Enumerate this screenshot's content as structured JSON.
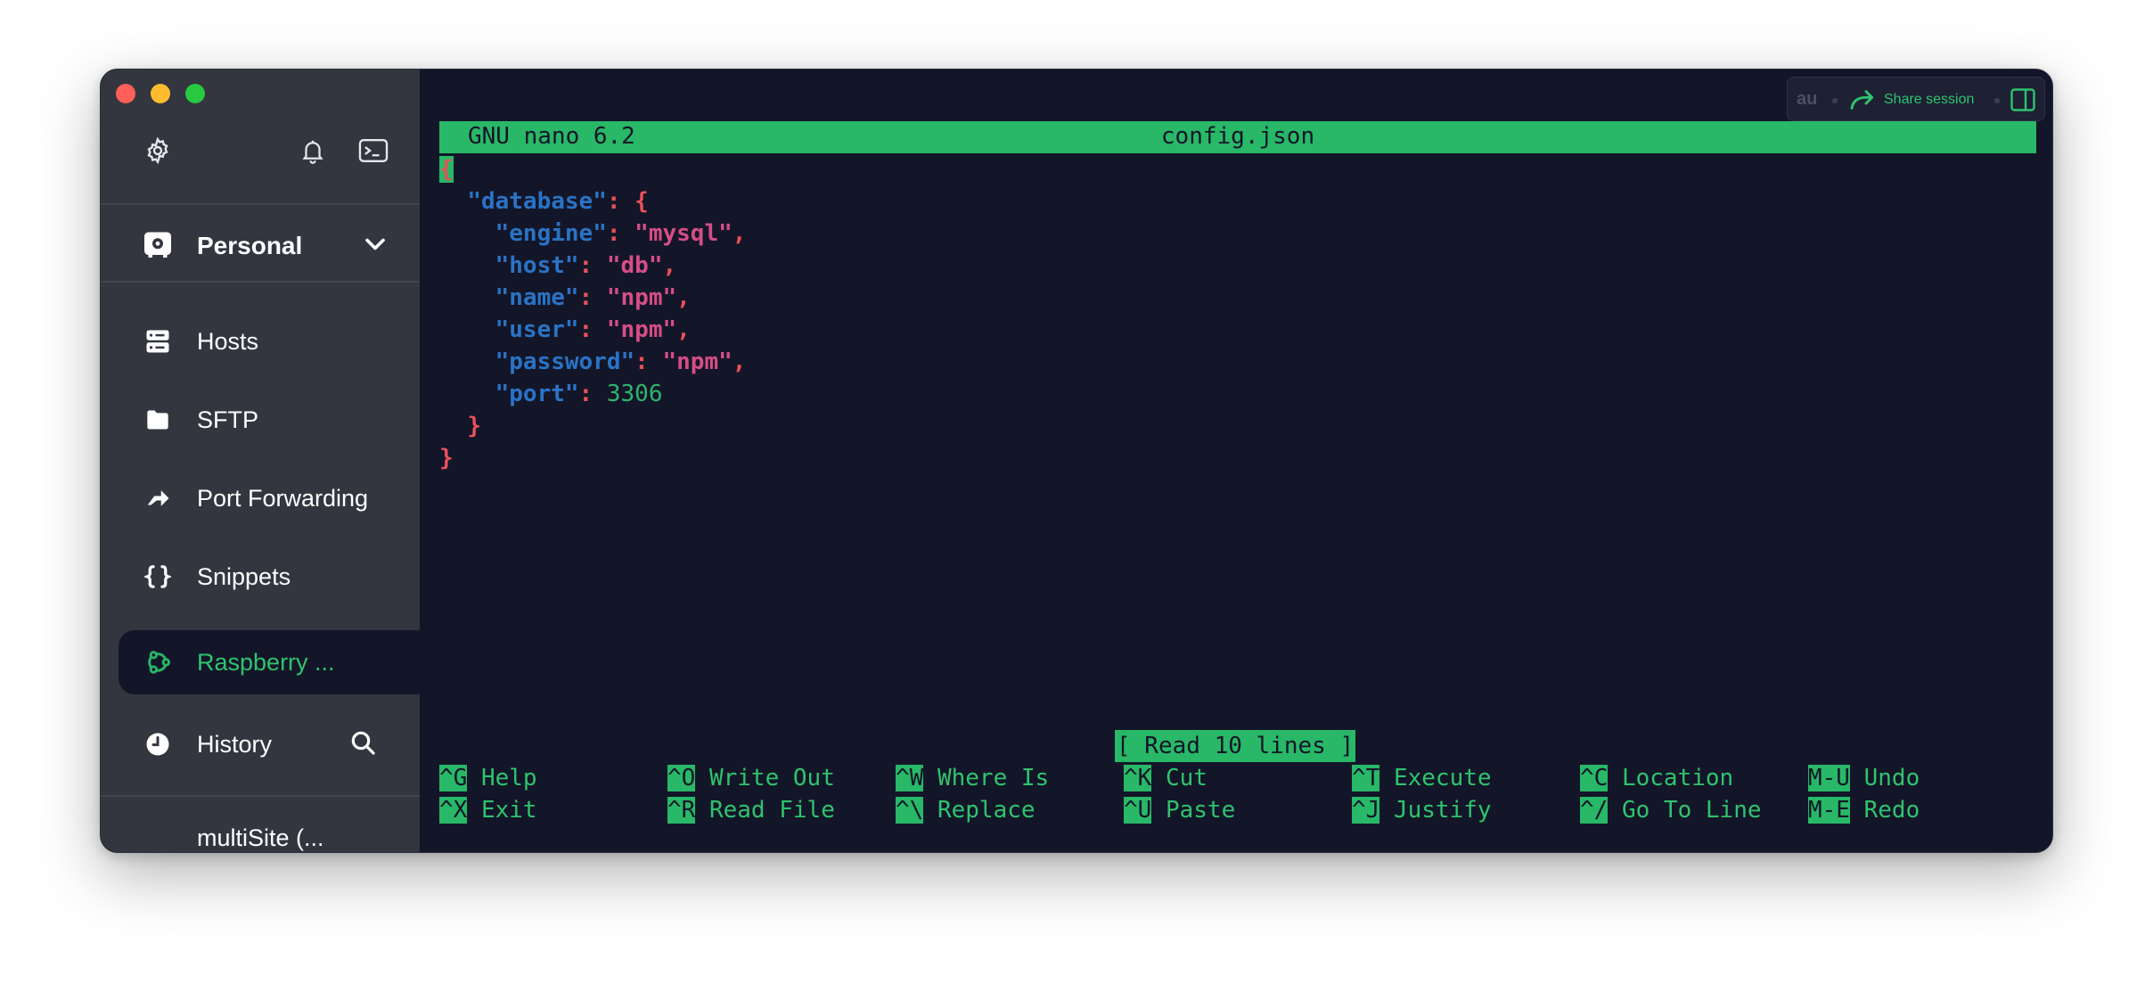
{
  "sidebar": {
    "workspace_label": "Personal",
    "nav": [
      {
        "label": "Hosts",
        "icon": "hosts-icon"
      },
      {
        "label": "SFTP",
        "icon": "folder-icon"
      },
      {
        "label": "Port Forwarding",
        "icon": "port-forwarding-icon"
      },
      {
        "label": "Snippets",
        "icon": "braces-icon"
      },
      {
        "label": "Raspberry ...",
        "icon": "ubuntu-icon",
        "active": true
      },
      {
        "label": "History",
        "icon": "clock-icon"
      },
      {
        "label": "multiSite (...",
        "icon": ""
      }
    ]
  },
  "share": {
    "prefix": "au",
    "label": "Share session"
  },
  "nano": {
    "version": "GNU nano 6.2",
    "filename": "config.json",
    "status": "[ Read 10 lines ]",
    "code": {
      "open_brace": "{",
      "database_key": "\"database\"",
      "engine_key": "\"engine\"",
      "engine_val": "\"mysql\"",
      "host_key": "\"host\"",
      "host_val": "\"db\"",
      "name_key": "\"name\"",
      "name_val": "\"npm\"",
      "user_key": "\"user\"",
      "user_val": "\"npm\"",
      "password_key": "\"password\"",
      "password_val": "\"npm\"",
      "port_key": "\"port\"",
      "port_val": "3306",
      "inner_close": "}",
      "outer_close": "}"
    },
    "shortcuts_row1": [
      {
        "key": "^G",
        "label": "Help"
      },
      {
        "key": "^O",
        "label": "Write Out"
      },
      {
        "key": "^W",
        "label": "Where Is"
      },
      {
        "key": "^K",
        "label": "Cut"
      },
      {
        "key": "^T",
        "label": "Execute"
      },
      {
        "key": "^C",
        "label": "Location"
      },
      {
        "key": "M-U",
        "label": "Undo"
      }
    ],
    "shortcuts_row2": [
      {
        "key": "^X",
        "label": "Exit"
      },
      {
        "key": "^R",
        "label": "Read File"
      },
      {
        "key": "^\\",
        "label": "Replace"
      },
      {
        "key": "^U",
        "label": "Paste"
      },
      {
        "key": "^J",
        "label": "Justify"
      },
      {
        "key": "^/",
        "label": "Go To Line"
      },
      {
        "key": "M-E",
        "label": "Redo"
      }
    ]
  }
}
